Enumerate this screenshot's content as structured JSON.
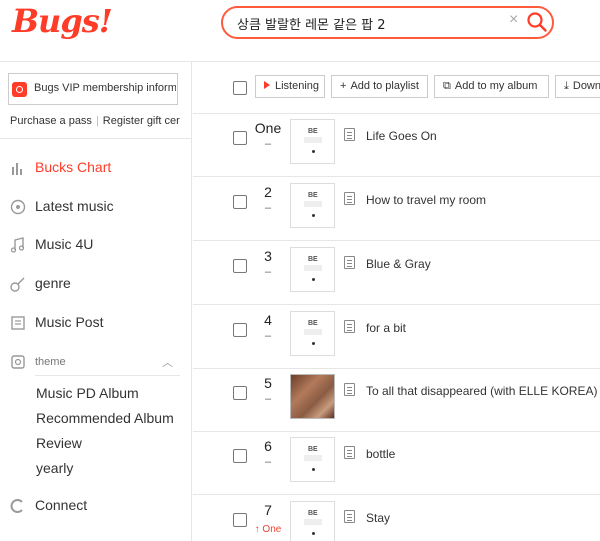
{
  "brand": {
    "logo": "Bugs!",
    "accent": "#ff3c28"
  },
  "search": {
    "query": "상큼 발랄한 레몬 같은 팝 2",
    "clear": "×"
  },
  "sidebar": {
    "vip_text": "Bugs VIP membership inform",
    "purchase": "Purchase a pass",
    "register": "Register gift cer",
    "nav": [
      {
        "label": "Bucks Chart",
        "icon": "chart-bars-icon",
        "active": true
      },
      {
        "label": "Latest music",
        "icon": "new-music-icon"
      },
      {
        "label": "Music 4U",
        "icon": "music-note-icon"
      },
      {
        "label": "genre",
        "icon": "guitar-icon"
      },
      {
        "label": "Music Post",
        "icon": "post-icon"
      },
      {
        "label": "theme",
        "icon": "theme-disc-icon"
      }
    ],
    "theme_items": [
      "Music PD Album",
      "Recommended Album",
      "Review",
      "yearly"
    ],
    "connect": "Connect"
  },
  "toolbar": {
    "listening": "Listening",
    "add_playlist": "Add to playlist",
    "add_album": "Add to my album",
    "download": "Down"
  },
  "tracks": [
    {
      "rank": "One",
      "change": "–",
      "title": "Life Goes On"
    },
    {
      "rank": "2",
      "change": "–",
      "title": "How to travel my room"
    },
    {
      "rank": "3",
      "change": "–",
      "title": "Blue & Gray"
    },
    {
      "rank": "4",
      "change": "–",
      "title": "for a bit"
    },
    {
      "rank": "5",
      "change": "–",
      "title": "To all that disappeared (with ELLE KOREA)"
    },
    {
      "rank": "6",
      "change": "–",
      "title": "bottle"
    },
    {
      "rank": "7",
      "change": "↑ One",
      "title": "Stay"
    }
  ]
}
